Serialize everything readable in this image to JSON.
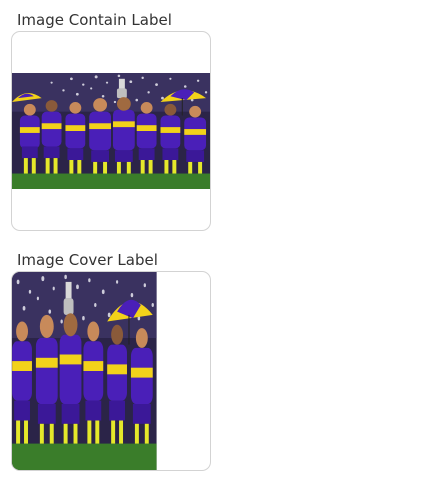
{
  "fields": [
    {
      "label": "Image Contain Label",
      "fit": "contain",
      "image_alt": "Team celebrating with trophy"
    },
    {
      "label": "Image Cover Label",
      "fit": "cover",
      "image_alt": "Team celebrating with trophy"
    }
  ],
  "colors": {
    "kit_blue": "#4a1fb8",
    "kit_yellow": "#f2d21a",
    "skin": "#c88a5a",
    "pitch": "#3a7d2a",
    "sky": "#2a2350",
    "trophy": "#d9d9d9"
  }
}
